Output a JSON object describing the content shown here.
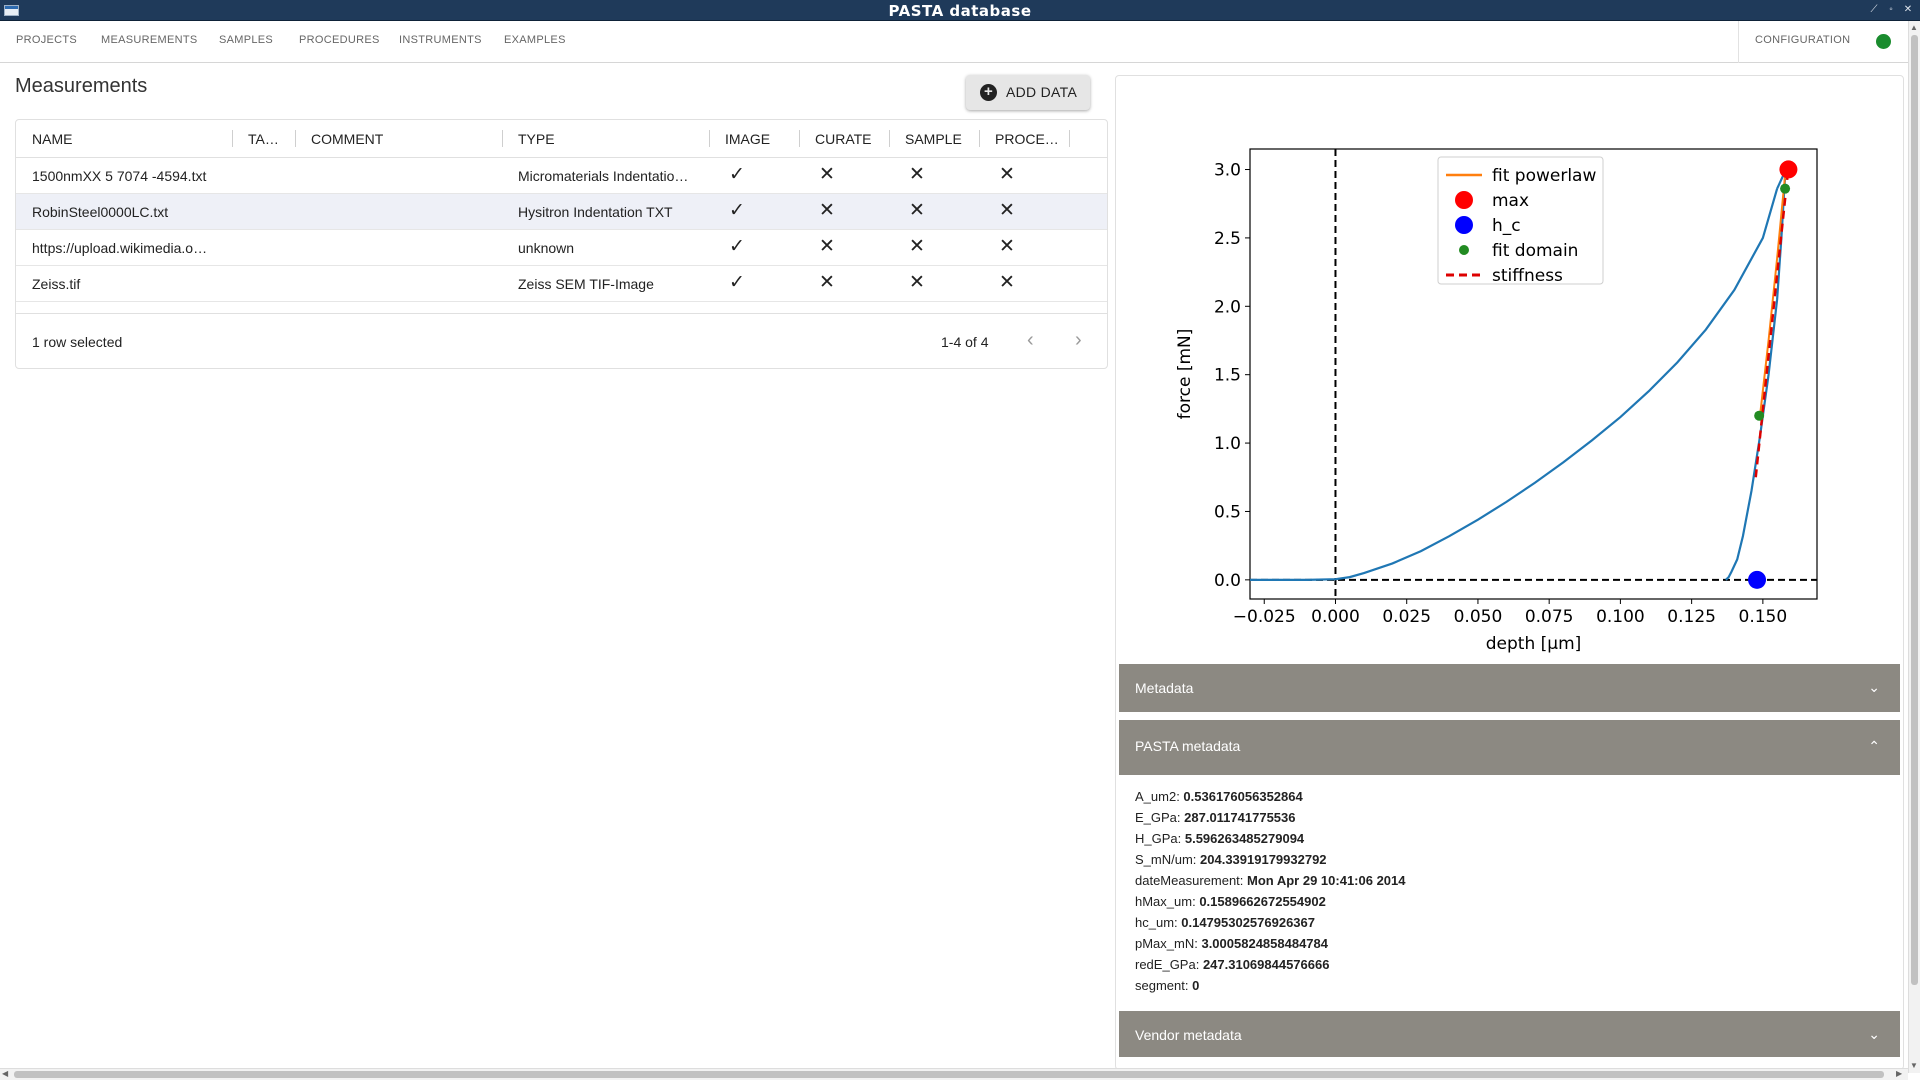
{
  "window": {
    "title": "PASTA database"
  },
  "nav": {
    "tabs": [
      "PROJECTS",
      "MEASUREMENTS",
      "SAMPLES",
      "PROCEDURES",
      "INSTRUMENTS",
      "EXAMPLES"
    ],
    "config": "CONFIGURATION",
    "status_color": "#1a8c2e"
  },
  "page": {
    "title": "Measurements",
    "add_button": "ADD DATA"
  },
  "table": {
    "columns": [
      "NAME",
      "TA…",
      "COMMENT",
      "TYPE",
      "IMAGE",
      "CURATE",
      "SAMPLE",
      "PROCE…"
    ],
    "rows": [
      {
        "name": "1500nmXX 5 7074 -4594.txt",
        "type": "Micromaterials Indentatio…",
        "image": "check",
        "curate": "x",
        "sample": "x",
        "procedure": "x"
      },
      {
        "name": "RobinSteel0000LC.txt",
        "type": "Hysitron Indentation TXT",
        "image": "check",
        "curate": "x",
        "sample": "x",
        "procedure": "x"
      },
      {
        "name": "https://upload.wikimedia.o…",
        "type": "unknown",
        "image": "check",
        "curate": "x",
        "sample": "x",
        "procedure": "x"
      },
      {
        "name": "Zeiss.tif",
        "type": "Zeiss SEM TIF-Image",
        "image": "check",
        "curate": "x",
        "sample": "x",
        "procedure": "x"
      }
    ],
    "selected_index": 1,
    "footer": {
      "selection": "1 row selected",
      "pagination": "1-4 of 4"
    }
  },
  "chart_data": {
    "type": "line",
    "xlabel": "depth [μm]",
    "ylabel": "force [mN]",
    "xlim": [
      -0.03,
      0.169
    ],
    "ylim": [
      -0.14,
      3.15
    ],
    "xticks": [
      "−0.025",
      "0.000",
      "0.025",
      "0.050",
      "0.075",
      "0.100",
      "0.125",
      "0.150"
    ],
    "yticks": [
      "0.0",
      "0.5",
      "1.0",
      "1.5",
      "2.0",
      "2.5",
      "3.0"
    ],
    "legend_position": "top-center",
    "series": [
      {
        "name": "",
        "color": "#1f77b4",
        "x": [
          -0.03,
          -0.02,
          -0.01,
          0.0,
          0.005,
          0.01,
          0.02,
          0.03,
          0.04,
          0.05,
          0.06,
          0.07,
          0.08,
          0.09,
          0.1,
          0.11,
          0.12,
          0.13,
          0.14,
          0.15,
          0.155
        ],
        "y": [
          0,
          0,
          0,
          0.005,
          0.02,
          0.05,
          0.12,
          0.21,
          0.32,
          0.44,
          0.57,
          0.71,
          0.86,
          1.02,
          1.19,
          1.38,
          1.59,
          1.83,
          2.12,
          2.5,
          2.86
        ]
      },
      {
        "name": "",
        "color": "#1f77b4",
        "x": [
          0.155,
          0.157,
          0.158,
          0.1575,
          0.1565,
          0.155,
          0.152,
          0.149,
          0.146,
          0.143,
          0.141,
          0.139,
          0.138,
          0.137
        ],
        "y": [
          2.86,
          2.95,
          3.0,
          2.85,
          2.5,
          2.05,
          1.5,
          1.05,
          0.65,
          0.32,
          0.15,
          0.06,
          0.02,
          0.0
        ]
      },
      {
        "name": "fit powerlaw",
        "color": "#ff7f0e",
        "x": [
          0.149,
          0.152,
          0.155,
          0.158
        ],
        "y": [
          1.2,
          1.75,
          2.35,
          3.0
        ]
      },
      {
        "name": "max",
        "color": "#ff0000",
        "x": [
          0.1589662672554902
        ],
        "y": [
          3.0005824858484784
        ]
      },
      {
        "name": "h_c",
        "color": "#0000ff",
        "x": [
          0.14795302576926367
        ],
        "y": [
          0.0
        ]
      },
      {
        "name": "fit domain",
        "color": "#228b22",
        "x": [
          0.1487,
          0.1578
        ],
        "y": [
          1.2,
          2.86
        ]
      },
      {
        "name": "stiffness",
        "color": "#dd0000",
        "x": [
          0.1475,
          0.1589
        ],
        "y": [
          0.75,
          3.0
        ]
      }
    ]
  },
  "accordions": {
    "metadata": "Metadata",
    "pasta_metadata": "PASTA metadata",
    "vendor_metadata": "Vendor metadata"
  },
  "metadata": [
    {
      "key": "A_um2:",
      "value": "0.536176056352864"
    },
    {
      "key": "E_GPa:",
      "value": "287.011741775536"
    },
    {
      "key": "H_GPa:",
      "value": "5.596263485279094"
    },
    {
      "key": "S_mN/um:",
      "value": "204.33919179932792"
    },
    {
      "key": "dateMeasurement:",
      "value": "Mon Apr 29 10:41:06 2014"
    },
    {
      "key": "hMax_um:",
      "value": "0.1589662672554902"
    },
    {
      "key": "hc_um:",
      "value": "0.14795302576926367"
    },
    {
      "key": "pMax_mN:",
      "value": "3.0005824858484784"
    },
    {
      "key": "redE_GPa:",
      "value": "247.31069844576666"
    },
    {
      "key": "segment:",
      "value": "0"
    }
  ]
}
